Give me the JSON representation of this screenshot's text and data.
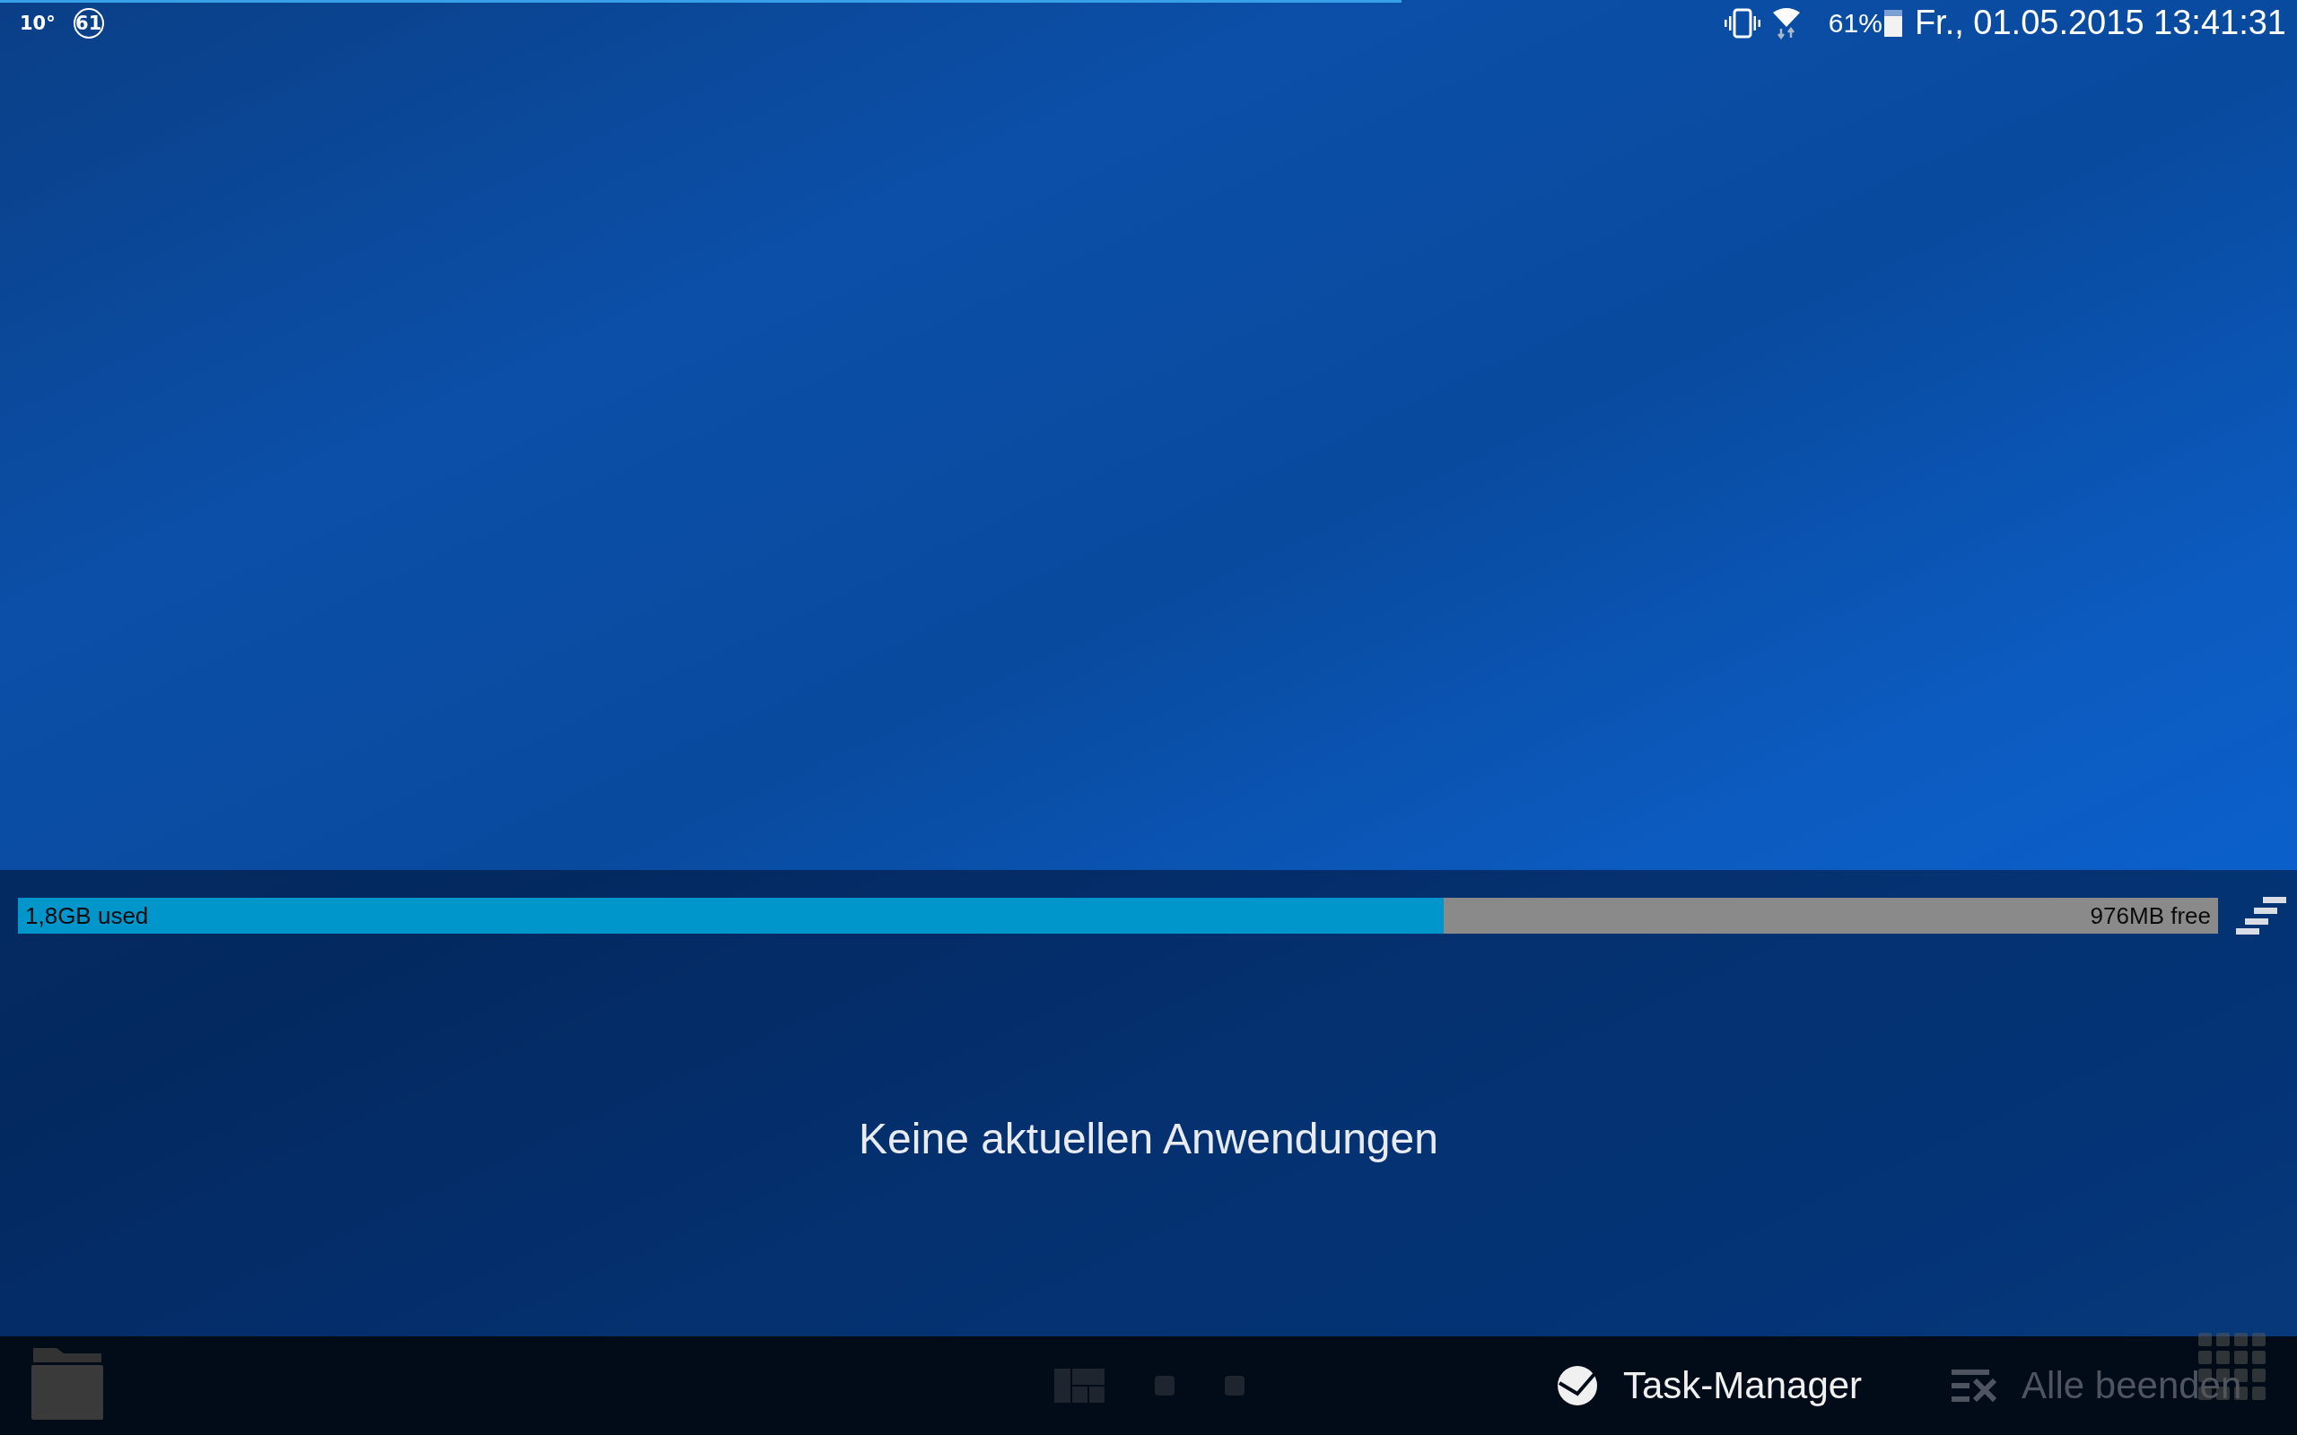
{
  "status_bar": {
    "progress": {
      "level": 0.61
    },
    "temperature": "10°",
    "notification_count": "61",
    "battery_percent": "61%",
    "battery": {
      "level": 0.75
    },
    "datetime": "Fr., 01.05.2015 13:41:31"
  },
  "memory": {
    "used_label": "1,8GB used",
    "free_label": "976MB free",
    "level": 0.648
  },
  "recents": {
    "empty_message": "Keine aktuellen Anwendungen"
  },
  "bottom_bar": {
    "task_manager": "Task-Manager",
    "close_all": {
      "label": "Alle beenden",
      "disabled": true
    }
  }
}
